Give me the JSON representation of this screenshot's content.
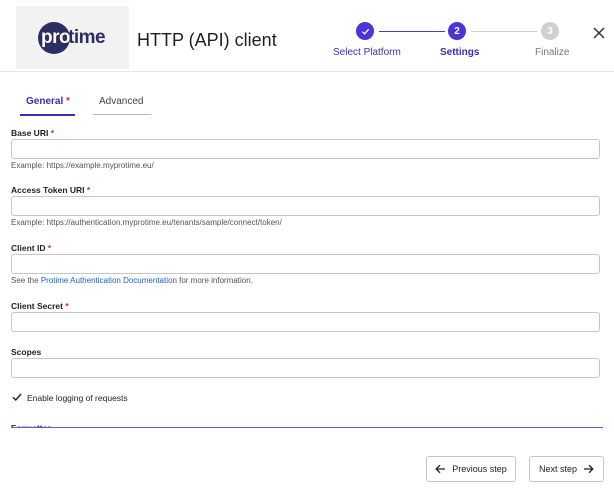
{
  "header": {
    "logo_left": "pro",
    "logo_right": "time",
    "title": "HTTP (API) client",
    "close_icon": "close-icon"
  },
  "stepper": {
    "steps": [
      {
        "number": "✓",
        "label": "Select Platform",
        "state": "completed"
      },
      {
        "number": "2",
        "label": "Settings",
        "state": "active"
      },
      {
        "number": "3",
        "label": "Finalize",
        "state": "pending"
      }
    ]
  },
  "tabs": [
    {
      "label": "General",
      "required_mark": "*",
      "active": true
    },
    {
      "label": "Advanced",
      "active": false
    }
  ],
  "fields": {
    "base_uri": {
      "label": "Base URI",
      "required_mark": "*",
      "value": "",
      "hint": "Example: https://example.myprotime.eu/"
    },
    "access_token_uri": {
      "label": "Access Token URI",
      "required_mark": "*",
      "value": "",
      "hint": "Example: https://authentication.myprotime.eu/tenants/sample/connect/token/"
    },
    "client_id": {
      "label": "Client ID",
      "required_mark": "*",
      "value": "",
      "hint_prefix": "See the ",
      "hint_link": "Protime Authentication Documentation",
      "hint_suffix": " for more information."
    },
    "client_secret": {
      "label": "Client Secret",
      "required_mark": "*",
      "value": ""
    },
    "scopes": {
      "label": "Scopes",
      "value": ""
    }
  },
  "logging": {
    "label": "Enable logging of requests",
    "checked": true
  },
  "formatter": {
    "label": "Formatter"
  },
  "footer": {
    "previous_label": "Previous step",
    "next_label": "Next step"
  },
  "colors": {
    "accent": "#3a2fb0",
    "step_active": "#4a35d6",
    "step_pending": "#d0d0d0",
    "link": "#1f5fbf",
    "required": "#d32f2f",
    "logo_navy": "#2b2d64"
  }
}
